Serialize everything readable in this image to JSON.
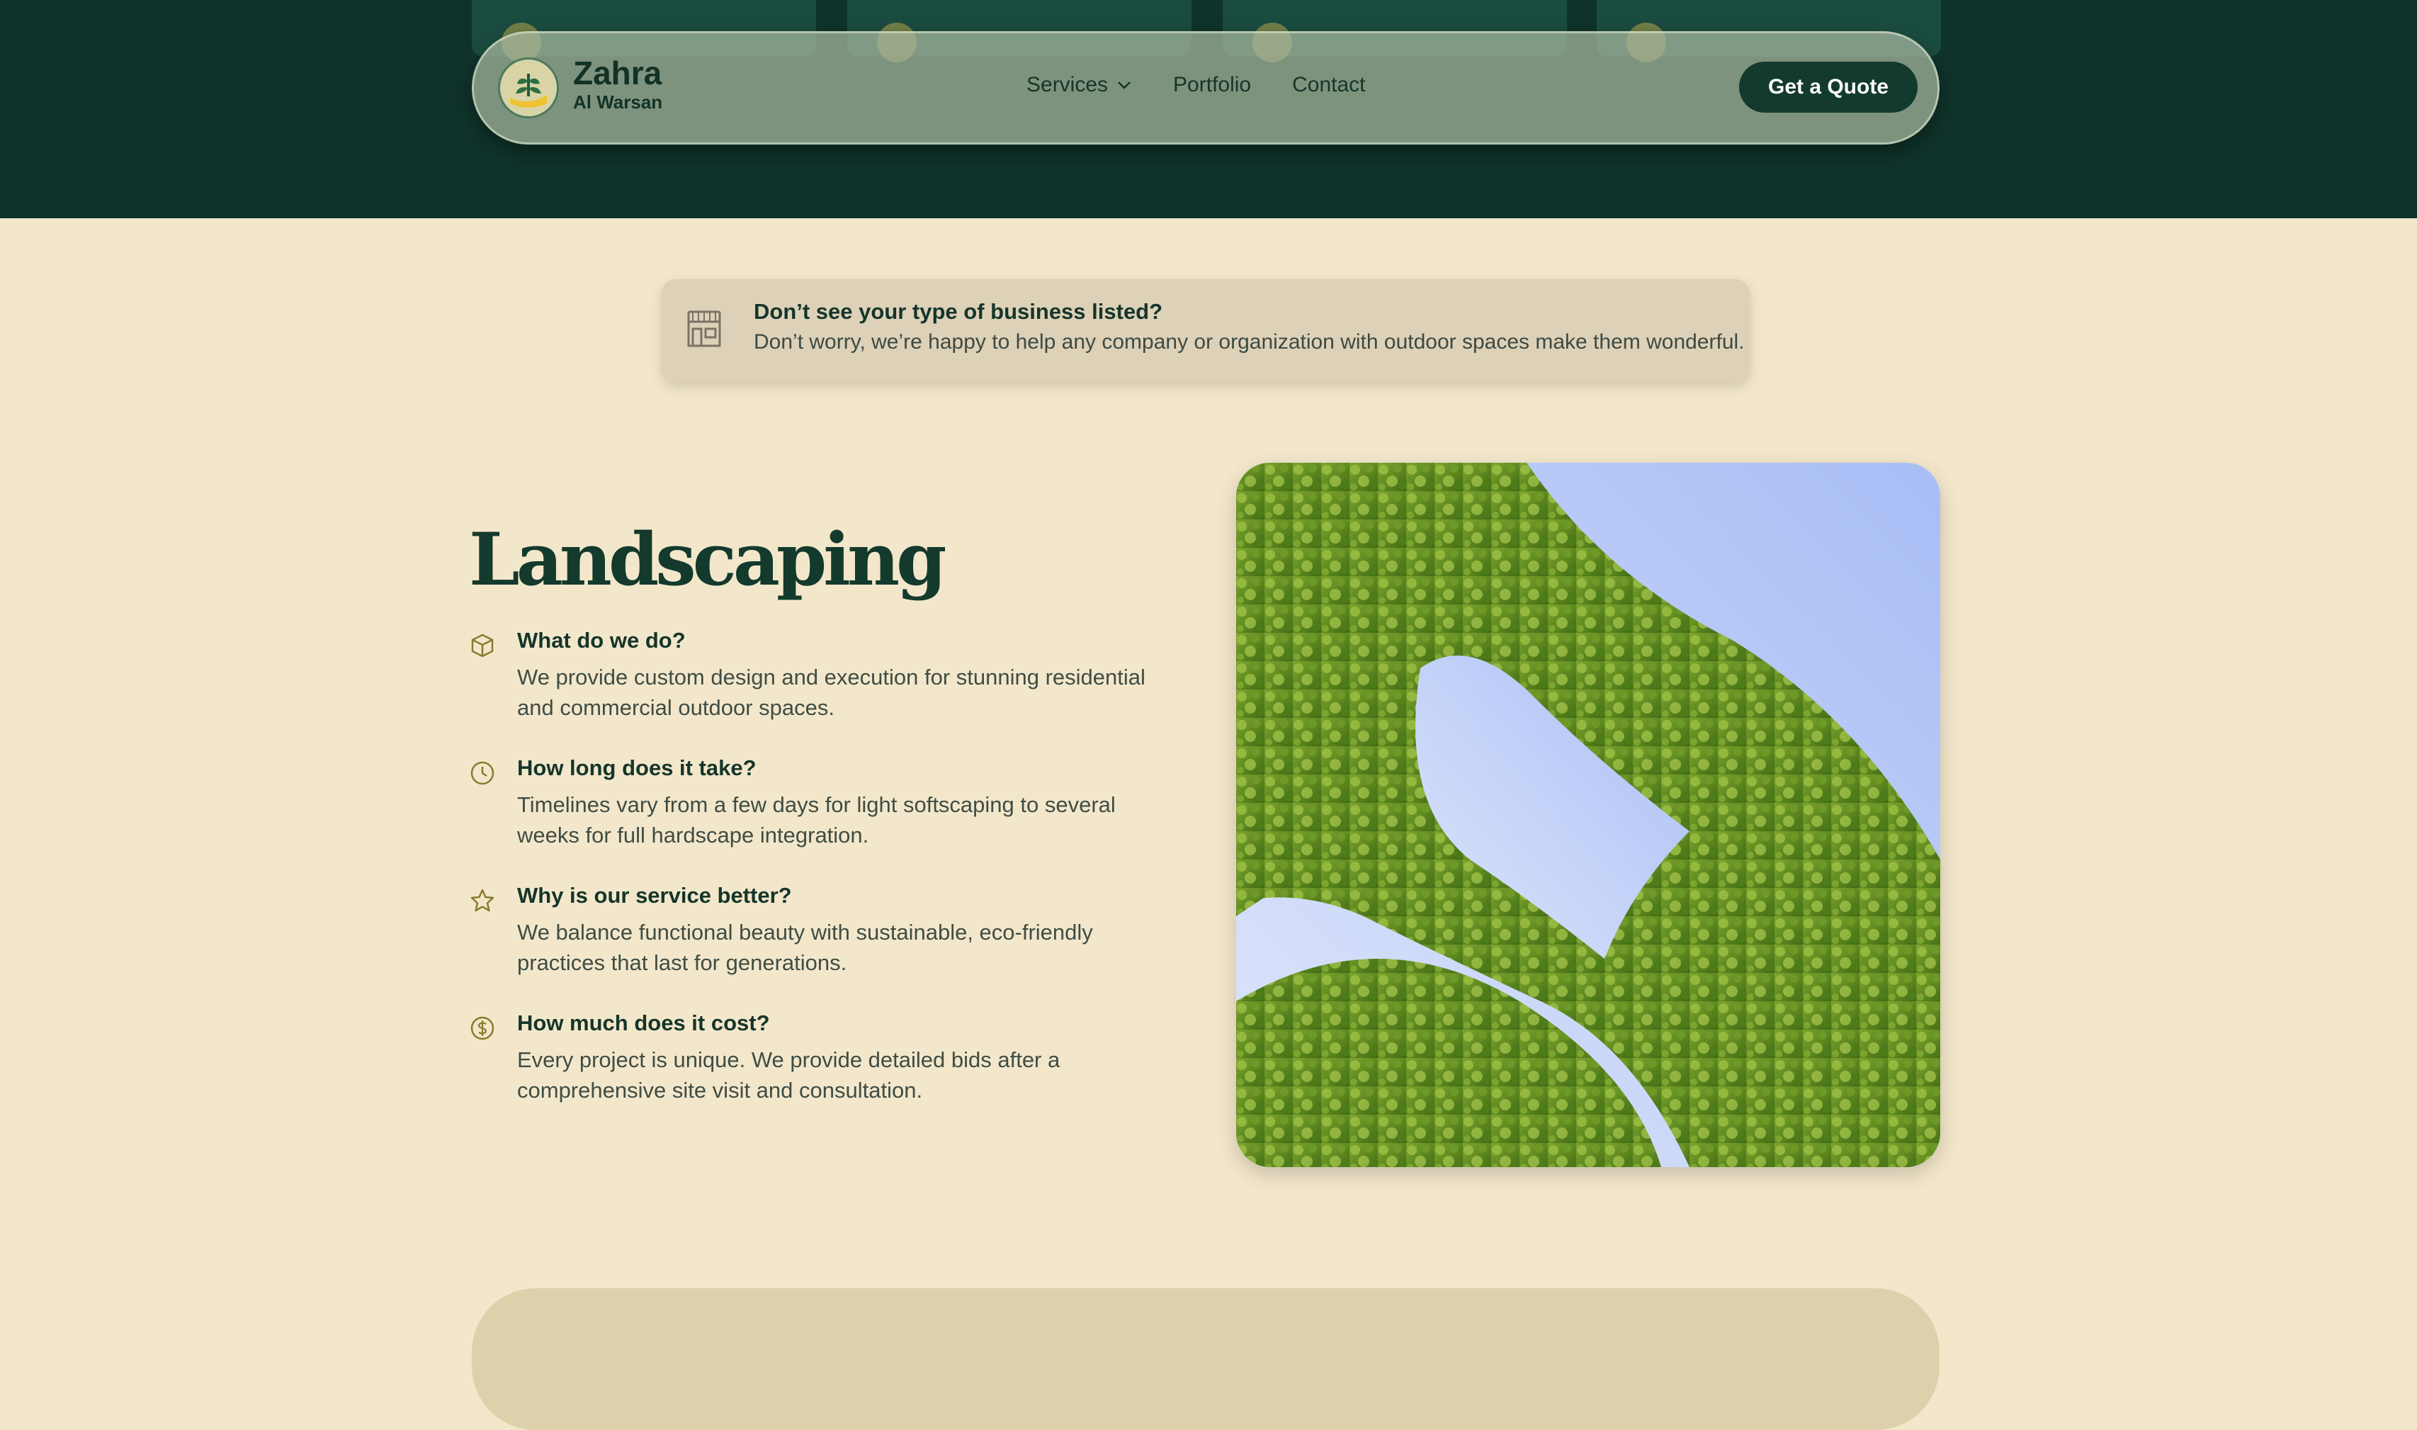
{
  "brand": {
    "name": "Zahra",
    "sub": "Al Warsan"
  },
  "nav": {
    "services": "Services",
    "portfolio": "Portfolio",
    "contact": "Contact",
    "cta": "Get a Quote"
  },
  "notice": {
    "title": "Don’t see your type of business listed?",
    "text": "Don’t worry, we’re happy to help any company or organization with outdoor spaces make them wonderful."
  },
  "section": {
    "title": "Landscaping",
    "faqs": [
      {
        "q": "What do we do?",
        "a": "We provide custom design and execution for stunning residential and commercial outdoor spaces.",
        "icon": "cube-icon"
      },
      {
        "q": "How long does it take?",
        "a": "Timelines vary from a few days for light softscaping to several weeks for full hardscape integration.",
        "icon": "clock-icon"
      },
      {
        "q": "Why is our service better?",
        "a": "We balance functional beauty with sustainable, eco-friendly practices that last for generations.",
        "icon": "star-icon"
      },
      {
        "q": "How much does it cost?",
        "a": "Every project is unique. We provide detailed bids after a comprehensive site visit and consultation.",
        "icon": "dollar-icon"
      }
    ]
  },
  "colors": {
    "hero": "#0f332a",
    "cream": "#f3e7cb",
    "accent": "#123a2d",
    "icon": "#8a7a2e"
  }
}
